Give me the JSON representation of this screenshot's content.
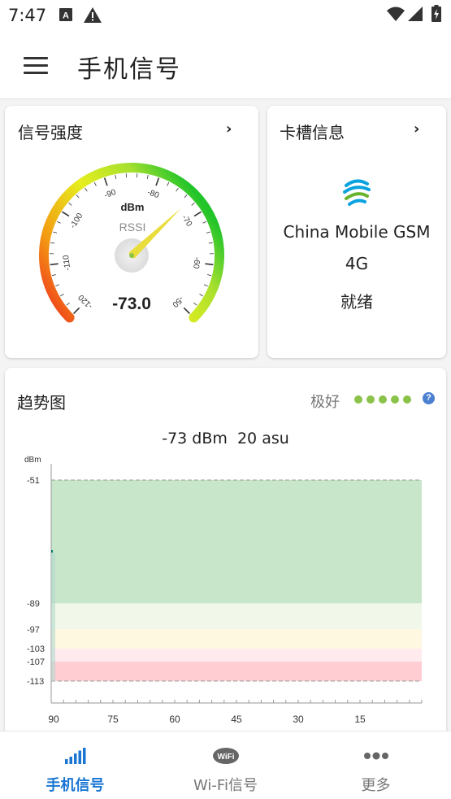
{
  "status_bar": {
    "time": "7:47",
    "left_icons": [
      "keyboard-icon",
      "alert-icon"
    ],
    "right_icons": [
      "wifi-icon",
      "cell-signal-icon",
      "battery-icon"
    ]
  },
  "app_bar": {
    "title": "手机信号",
    "menu_icon": "hamburger-menu-icon"
  },
  "signal_card": {
    "title": "信号强度",
    "unit": "dBm",
    "metric": "RSSI",
    "value": "-73.0",
    "needle_value": -73,
    "gauge_min": -120,
    "gauge_max": -50,
    "ticks": [
      "-120",
      "-110",
      "-100",
      "-90",
      "-80",
      "-70",
      "-60",
      "-50"
    ]
  },
  "sim_card": {
    "title": "卡槽信息",
    "carrier": "China Mobile GSM",
    "network": "4G",
    "status": "就绪",
    "logo_icon": "china-mobile-logo-icon"
  },
  "trend_card": {
    "title": "趋势图",
    "quality": "极好",
    "quality_dots": 5,
    "quality_color": "#8bc34a",
    "help_icon": "help-icon",
    "help_mark": "?",
    "reading": "-73 dBm  20 asu"
  },
  "chart_data": {
    "type": "area",
    "ylabel": "dBm",
    "y_ticks": [
      "-51",
      "-89",
      "-97",
      "-103",
      "-107",
      "-113"
    ],
    "x_ticks": [
      "90",
      "75",
      "60",
      "45",
      "30",
      "15"
    ],
    "ylim": [
      -113,
      -51
    ],
    "xlim": [
      90,
      0
    ],
    "zones": [
      {
        "from": -113,
        "to": -107,
        "color": "#ffcdd2"
      },
      {
        "from": -107,
        "to": -103,
        "color": "#ffebee"
      },
      {
        "from": -103,
        "to": -97,
        "color": "#fff8e1"
      },
      {
        "from": -97,
        "to": -89,
        "color": "#f1f8e9"
      },
      {
        "from": -89,
        "to": -51,
        "color": "#c8e6c9"
      }
    ],
    "series": [
      {
        "x": [
          90,
          89.6
        ],
        "y": [
          -73,
          -73
        ],
        "color": "#00796b"
      }
    ]
  },
  "bottom_nav": {
    "items": [
      {
        "label": "手机信号",
        "icon": "signal-bars-icon",
        "active": true
      },
      {
        "label": "Wi-Fi信号",
        "icon": "wifi-badge-icon",
        "badge": "WiFi",
        "active": false
      },
      {
        "label": "更多",
        "icon": "more-dots-icon",
        "active": false
      }
    ]
  },
  "colors": {
    "accent": "#1976d2",
    "good": "#8bc34a",
    "bad": "#f44336"
  }
}
